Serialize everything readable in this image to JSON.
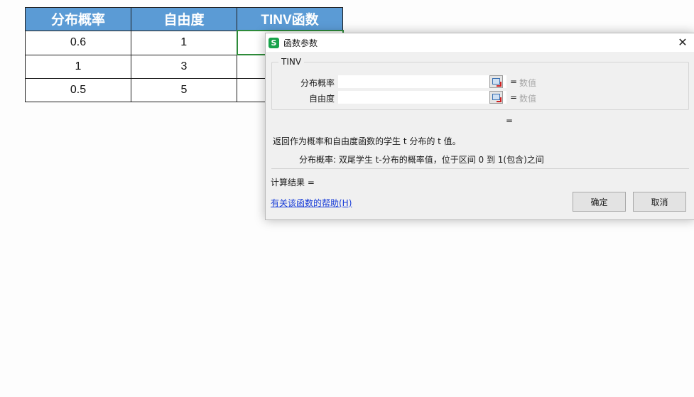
{
  "sheet": {
    "headers": [
      "分布概率",
      "自由度",
      "TINV函数"
    ],
    "rows": [
      [
        "0.6",
        "1",
        ""
      ],
      [
        "1",
        "3",
        ""
      ],
      [
        "0.5",
        "5",
        ""
      ]
    ]
  },
  "dialog": {
    "title": "函数参数",
    "app_icon_letter": "S",
    "close_glyph": "✕",
    "function_name": "TINV",
    "args": [
      {
        "label": "分布概率",
        "value": "",
        "equals": "=",
        "hint": "数值"
      },
      {
        "label": "自由度",
        "value": "",
        "equals": "=",
        "hint": "数值"
      }
    ],
    "result_equals": "=",
    "description": "返回作为概率和自由度函数的学生 t 分布的 t 值。",
    "param_description": "分布概率:   双尾学生 t-分布的概率值，位于区间 0 到 1(包含)之间",
    "calc_result": "计算结果  =",
    "help_link": "有关该函数的帮助(H)",
    "ok_label": "确定",
    "cancel_label": "取消"
  },
  "colors": {
    "header_bg": "#5b9bd5",
    "active_cell_border": "#2e8b3a",
    "app_icon": "#17a34a",
    "link": "#1a3ed8"
  }
}
